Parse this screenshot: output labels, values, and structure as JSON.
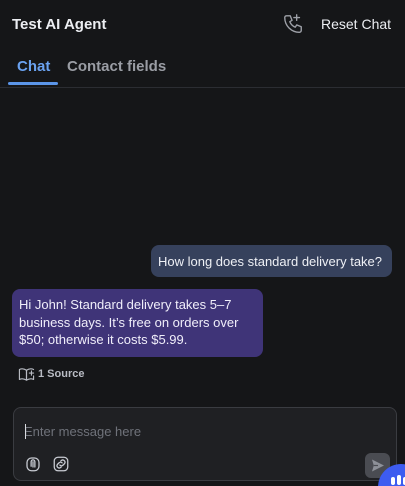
{
  "header": {
    "title": "Test AI Agent",
    "reset_label": "Reset Chat",
    "call_icon": "phone-call-icon"
  },
  "tabs": [
    {
      "label": "Chat",
      "active": true
    },
    {
      "label": "Contact fields",
      "active": false
    }
  ],
  "messages": [
    {
      "role": "user",
      "text": "How long does standard delivery take?"
    },
    {
      "role": "agent",
      "lines": [
        "Hi John! Standard delivery takes 5–7",
        "business days. It’s free on orders over",
        "$50; otherwise it costs $5.99."
      ]
    }
  ],
  "sources": {
    "label": "1 Source",
    "icon": "book-icon"
  },
  "composer": {
    "placeholder": "Enter message here",
    "value": "",
    "attach_icon": "paperclip-icon",
    "link_icon": "link-icon",
    "send_icon": "send-icon"
  },
  "colors": {
    "background": "#151618",
    "accent": "#5b95e8",
    "user_bubble": "#36415c",
    "agent_bubble": "#3f3478",
    "widget": "#3d5cf0"
  }
}
